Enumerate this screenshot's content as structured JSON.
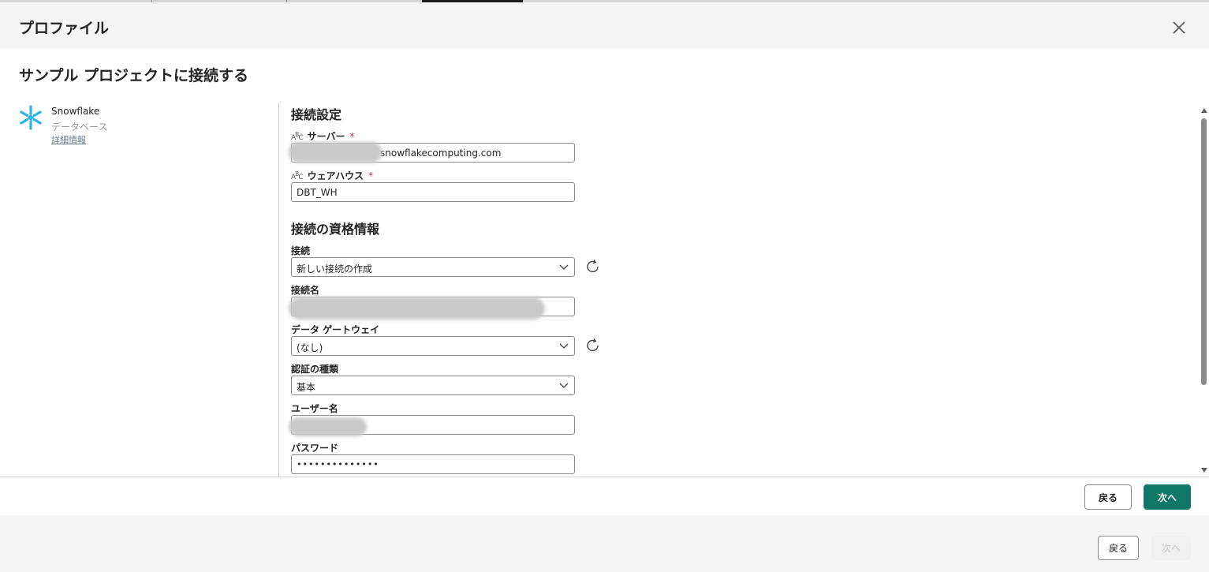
{
  "dialog": {
    "title": "プロファイル",
    "close_icon": "close-icon"
  },
  "page": {
    "heading": "サンプル プロジェクトに接続する"
  },
  "source": {
    "name": "Snowflake",
    "type": "データベース",
    "link": "詳細情報",
    "logo_icon": "snowflake-logo",
    "logo_color": "#29b5e8"
  },
  "connection_settings": {
    "title": "接続設定",
    "server": {
      "label": "サーバー",
      "required_mark": "*",
      "value_suffix": "snowflakecomputing.com"
    },
    "warehouse": {
      "label": "ウェアハウス",
      "required_mark": "*",
      "value": "DBT_WH"
    }
  },
  "credentials": {
    "title": "接続の資格情報",
    "connection": {
      "label": "接続",
      "value": "新しい接続の作成"
    },
    "connection_name": {
      "label": "接続名"
    },
    "gateway": {
      "label": "データ ゲートウェイ",
      "value": "(なし)"
    },
    "auth_type": {
      "label": "認証の種類",
      "value": "基本"
    },
    "username": {
      "label": "ユーザー名"
    },
    "password": {
      "label": "パスワード",
      "value": "••••••••••••••"
    }
  },
  "footer": {
    "back_label": "戻る",
    "next_label": "次へ"
  },
  "outer_footer": {
    "back_label": "戻る",
    "next_label": "次へ"
  },
  "colors": {
    "primary": "#117865",
    "required": "#c4314b",
    "border": "#8a8a8a"
  }
}
